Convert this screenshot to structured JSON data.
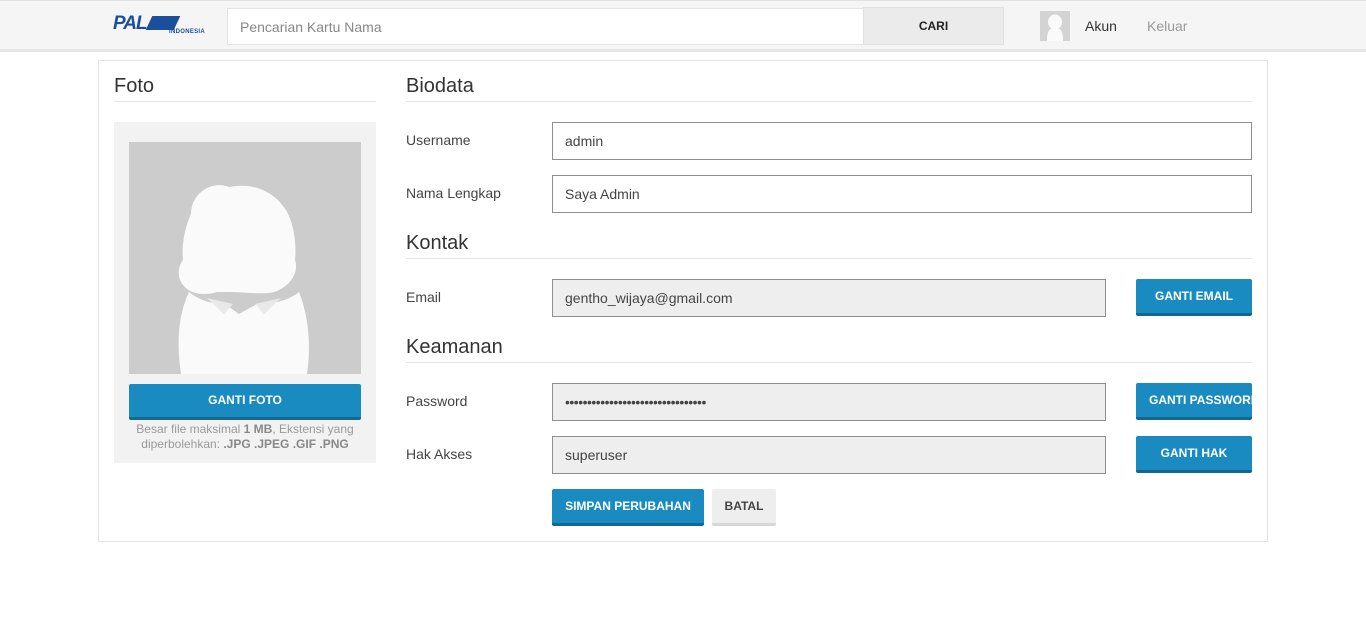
{
  "header": {
    "logo_text": "PAL",
    "logo_sub": "INDONESIA",
    "search_placeholder": "Pencarian Kartu Nama",
    "search_button": "CARI",
    "account_label": "Akun",
    "logout_label": "Keluar"
  },
  "photo": {
    "title": "Foto",
    "change_button": "GANTI FOTO",
    "note_prefix": "Besar file maksimal ",
    "note_size": "1 MB",
    "note_mid": ", Ekstensi yang diperbolehkan: ",
    "note_ext": ".JPG .JPEG .GIF .PNG"
  },
  "biodata": {
    "title": "Biodata",
    "username_label": "Username",
    "username_value": "admin",
    "fullname_label": "Nama Lengkap",
    "fullname_value": "Saya Admin"
  },
  "kontak": {
    "title": "Kontak",
    "email_label": "Email",
    "email_value": "gentho_wijaya@gmail.com",
    "change_email_button": "GANTI EMAIL"
  },
  "keamanan": {
    "title": "Keamanan",
    "password_label": "Password",
    "password_value": "••••••••••••••••••••••••••••••••",
    "change_password_button": "GANTI PASSWORD",
    "access_label": "Hak Akses",
    "access_value": "superuser",
    "change_access_button": "GANTI HAK"
  },
  "actions": {
    "save_button": "SIMPAN PERUBAHAN",
    "cancel_button": "BATAL"
  },
  "colors": {
    "primary": "#1a8bc0",
    "primary_dark": "#13688f",
    "logo": "#1b4f9c"
  }
}
